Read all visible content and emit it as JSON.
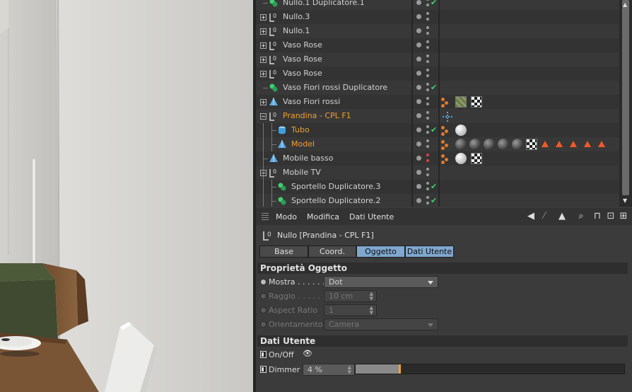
{
  "object_manager": {
    "rows": [
      {
        "name": "Nullo.1 Duplicatore.1",
        "type": "generator",
        "expand": "none",
        "check": true,
        "selected": false
      },
      {
        "name": "Nullo.3",
        "type": "null",
        "expand": "plus",
        "check": false,
        "selected": false
      },
      {
        "name": "Nullo.1",
        "type": "null",
        "expand": "plus",
        "check": false,
        "selected": false
      },
      {
        "name": "Vaso Rose",
        "type": "null",
        "expand": "plus",
        "check": false,
        "selected": false
      },
      {
        "name": "Vaso Rose",
        "type": "null",
        "expand": "plus",
        "check": false,
        "selected": false
      },
      {
        "name": "Vaso Rose",
        "type": "null",
        "expand": "plus",
        "check": false,
        "selected": false
      },
      {
        "name": "Vaso Fiori rossi Duplicatore",
        "type": "generator",
        "expand": "none",
        "check": true,
        "selected": false
      },
      {
        "name": "Vaso Fiori rossi",
        "type": "polygon",
        "expand": "plus",
        "check": false,
        "selected": false
      },
      {
        "name": "Prandina - CPL F1",
        "type": "null",
        "expand": "minus",
        "check": false,
        "selected": true
      },
      {
        "name": "Tubo",
        "type": "tube",
        "expand": "child",
        "check": true,
        "selected": true
      },
      {
        "name": "Model",
        "type": "polygon",
        "expand": "child",
        "check": false,
        "selected": true
      },
      {
        "name": "Mobile basso",
        "type": "polygon",
        "expand": "none",
        "check": false,
        "selected": false
      },
      {
        "name": "Mobile TV",
        "type": "null",
        "expand": "minus",
        "check": false,
        "selected": false
      },
      {
        "name": "Sportello Duplicatore.3",
        "type": "generator",
        "expand": "child",
        "check": true,
        "selected": false
      },
      {
        "name": "Sportello Duplicatore.2",
        "type": "generator",
        "expand": "child",
        "check": true,
        "selected": false
      }
    ],
    "icons": {
      "null": "null-object-icon",
      "generator": "cloner-icon",
      "polygon": "polygon-object-icon",
      "tube": "tube-icon"
    },
    "scroll_up": "▲",
    "scroll_down": "▼"
  },
  "attribute_manager": {
    "menu": [
      "Modo",
      "Modifica",
      "Dati Utente"
    ],
    "toolbar_icons": [
      "back-arrow-icon",
      "up-arrow-icon",
      "search-icon",
      "lock-icon",
      "new-panel-icon",
      "add-panel-icon"
    ],
    "object_title": "Nullo [Prandina - CPL F1]",
    "tabs": [
      {
        "label": "Base",
        "active": false
      },
      {
        "label": "Coord.",
        "active": false
      },
      {
        "label": "Oggetto",
        "active": true
      },
      {
        "label": "Dati Utente",
        "active": true
      }
    ],
    "section_object": "Proprietà Oggetto",
    "props": {
      "mostra": {
        "label": "Mostra . . . . . .",
        "value": "Dot"
      },
      "raggio": {
        "label": "Raggio . . . . . .",
        "value": "10 cm"
      },
      "aspect": {
        "label": "Aspect Ratio",
        "value": "1"
      },
      "orient": {
        "label": "Orientamento",
        "value": "Camera"
      }
    },
    "section_user": "Dati Utente",
    "user": {
      "onoff_label": "On/Off",
      "dimmer_label": "Dimmer",
      "dimmer_value": "4 %",
      "dimmer_fraction": 0.04
    }
  },
  "colors": {
    "selected": "#f0a030",
    "tab_active": "#7fa7cf",
    "check": "#3fd06e"
  }
}
